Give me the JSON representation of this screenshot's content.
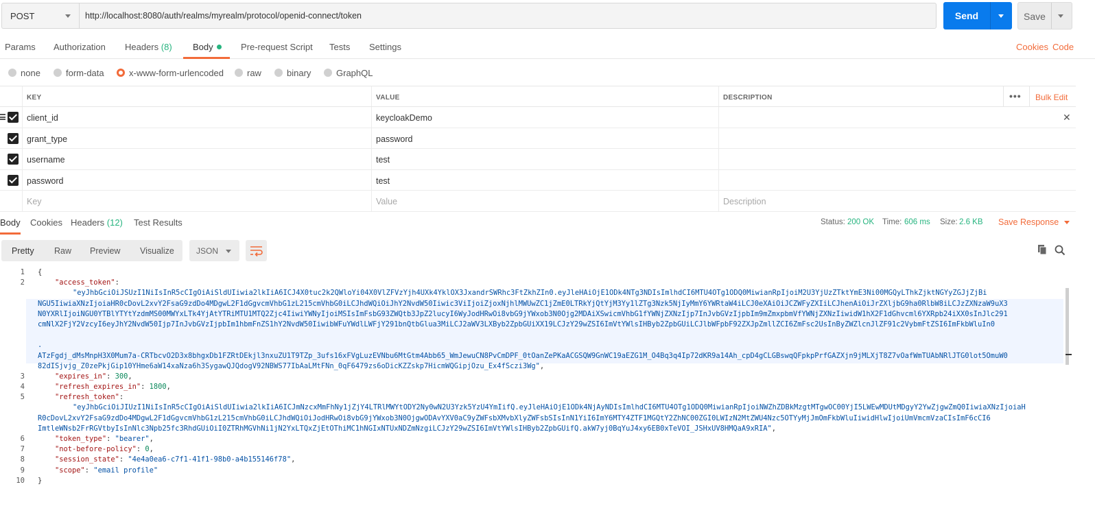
{
  "request": {
    "method": "POST",
    "url": "http://localhost:8080/auth/realms/myrealm/protocol/openid-connect/token",
    "send_label": "Send",
    "save_label": "Save"
  },
  "request_tabs": {
    "params": "Params",
    "authorization": "Authorization",
    "headers": "Headers",
    "headers_count": "(8)",
    "body": "Body",
    "prerequest": "Pre-request Script",
    "tests": "Tests",
    "settings": "Settings",
    "cookies": "Cookies",
    "code": "Code"
  },
  "body_types": [
    "none",
    "form-data",
    "x-www-form-urlencoded",
    "raw",
    "binary",
    "GraphQL"
  ],
  "body_type_selected": "x-www-form-urlencoded",
  "params_table": {
    "headers": {
      "key": "KEY",
      "value": "VALUE",
      "description": "DESCRIPTION"
    },
    "bulk_edit": "Bulk Edit",
    "rows": [
      {
        "key": "client_id",
        "value": "keycloakDemo",
        "checked": true
      },
      {
        "key": "grant_type",
        "value": "password",
        "checked": true
      },
      {
        "key": "username",
        "value": "test",
        "checked": true
      },
      {
        "key": "password",
        "value": "test",
        "checked": true
      }
    ],
    "placeholders": {
      "key": "Key",
      "value": "Value",
      "description": "Description"
    }
  },
  "response_tabs": {
    "body": "Body",
    "cookies": "Cookies",
    "headers": "Headers",
    "headers_count": "(12)",
    "test_results": "Test Results"
  },
  "response_status": {
    "status_label": "Status:",
    "status_value": "200 OK",
    "time_label": "Time:",
    "time_value": "606 ms",
    "size_label": "Size:",
    "size_value": "2.6 KB",
    "save_response": "Save Response"
  },
  "view_modes": {
    "pretty": "Pretty",
    "raw": "Raw",
    "preview": "Preview",
    "visualize": "Visualize",
    "format": "JSON"
  },
  "code": {
    "line_numbers": [
      "1",
      "2",
      "3",
      "4",
      "5",
      "6",
      "7",
      "8",
      "9",
      "10"
    ],
    "open_brace": "{",
    "close_brace": "}",
    "access_token_key": "\"access_token\"",
    "access_token_lines": [
      "\"eyJhbGciOiJSUzI1NiIsInR5cCIgOiAiSldUIiwia2lkIiA6ICJ4X0tuc2k2QWloYi04X0VlZFVzYjh4UXk4YklOX3JxandrSWRhc3FtZkhZIn0.eyJleHAiOjE1ODk4NTg3NDIsImlhdCI6MTU4OTg1ODQ0MiwianRpIjoiM2U3YjUzZTktYmE3Ni00MGQyLThkZjktNGYyZGJjZjBiNGU5IiwiaXNzIjoiaHR0cDovL2xvY2FsaG9zdDo4MDgwL2F1dGgvcmVhbG1zL215cmVhbG0iLCJhdWQiOiJhY2NvdW50Iiwic3ViIjoiZjoxNjhlMWUwZC1jZmE0LTRkYjQtYjM3Yy1lZTg3Nzk5NjIyMmY6YWRtaW4iLCJ0eXAiOiJCZWFyZXIiLCJhenAiOiJrZXljbG9ha0RlbW8iLCJzZXNzaW9uX3N0YXRlIjoiNGU0YTBlYTYtYzdmMS00MWYxLTk4YjAtYTRiMTU1MTQ2Zjc4IiwiYWNyIjoiMSIsImFsbG93ZWQtb3JpZ2lucyI6WyJodHRwOi8vbG9jYWxob3N0Ojg2MDAiXSwicmVhbG1fYWNjZXNzIjp7InJvbGVzIjpbIm9mZmxpbmVfYWNjZXNzIiwidW1hX2F1dGhvcml6YXRpb24iXX0sInJlc291cmNlX2FjY2VzcyI6eyJhY2NvdW50Ijp7InJvbGVzIjpbIm1hbmFnZS1hY2NvdW50IiwibWFuYWdlLWFjY291bnQtbGlua3MiLCJ2aWV3LXByb2ZpbGUiXX19LCJzY29wZSI6ImVtYWlsIHByb2ZpbGUiLCJlbWFpbF92ZXJpZmllZCI6ZmFsc2UsInByZWZlcnJlZF91c2VybmFtZSI6ImFkbWluIn0",
      ".",
      "ATzFgdj_dMsMnpH3X0Mum7a-CRTbcvO2D3x8bhgxDb1FZRtDEkjl3nxuZU1T9TZp_3ufs16xFVgLuzEVNbu6MtGtm4Abb65_WmJewuCN8PvCmDPF_0tOanZePKaACGSQW9GnWC19aEZG1M_O4Bq3q4Ip72dKR9a14Ah_cpD4gCLGBswqQFpkpPrfGAZXjn9jMLXjT8Z7vOafWmTUAbNRlJTG0lot5OmuW082dISjvjg_Z0zePkjGip10YHme6aW14xaNza6h3SygawQJQdogV92NBWS77IbAaLMtFNn_0qF6479zs6oDicKZZskp7HicmWQGipjOzu_Ex4fSczi3Wg\""
    ],
    "expires_in_key": "\"expires_in\"",
    "expires_in_value": "300",
    "refresh_expires_in_key": "\"refresh_expires_in\"",
    "refresh_expires_in_value": "1800",
    "refresh_token_key": "\"refresh_token\"",
    "refresh_token_lines": [
      "\"eyJhbGciOiJIUzI1NiIsInR5cCIgOiAiSldUIiwia2lkIiA6ICJmNzcxMmFhNy1jZjY4LTRlMWYtODY2Ny0wN2U3Yzk5YzU4YmIifQ.eyJleHAiOjE1ODk4NjAyNDIsImlhdCI6MTU4OTg1ODQ0MiwianRpIjoiNWZhZDBkMzgtMTgwOC00YjI5LWEwMDUtMDgyY2YwZjgwZmQ0IiwiaXNzIjoiaH",
      "R0cDovL2xvY2FsaG9zdDo4MDgwL2F1dGgvcmVhbG1zL215cmVhbG0iLCJhdWQiOiJodHRwOi8vbG9jYWxob3N0OjgwODAvYXV0aC9yZWFsbXMvbXlyZWFsbSIsInN1YiI6ImY6MTY4ZTF1MGQtY2ZhNC00ZGI0LWIzN2MtZWU4Nzc5OTYyMjJmOmFkbWluIiwidHlwIjoiUmVmcmVzaCIsImF6cCI6",
      "ImtleWNsb2FrRGVtbyIsInNlc3Npb25fc3RhdGUiOiI0ZTRhMGVhNi1jN2YxLTQxZjEtOThiMC1hNGIxNTUxNDZmNzgiLCJzY29wZSI6ImVtYWlsIHByb2ZpbGUifQ.akW7yj0BqYuJ4xy6EB0xTeVOI_JSHxUV8HMQaA9xRIA\""
    ],
    "token_type_key": "\"token_type\"",
    "token_type_value": "\"bearer\"",
    "not_before_policy_key": "\"not-before-policy\"",
    "not_before_policy_value": "0",
    "session_state_key": "\"session_state\"",
    "session_state_value": "\"4e4a0ea6-c7f1-41f1-98b0-a4b155146f78\"",
    "scope_key": "\"scope\"",
    "scope_value": "\"email profile\""
  },
  "colors": {
    "accent": "#f26b3a",
    "send": "#097bed",
    "success": "#26b47f",
    "json_key": "#a31515",
    "json_string": "#0451a5",
    "json_number": "#09885a"
  }
}
